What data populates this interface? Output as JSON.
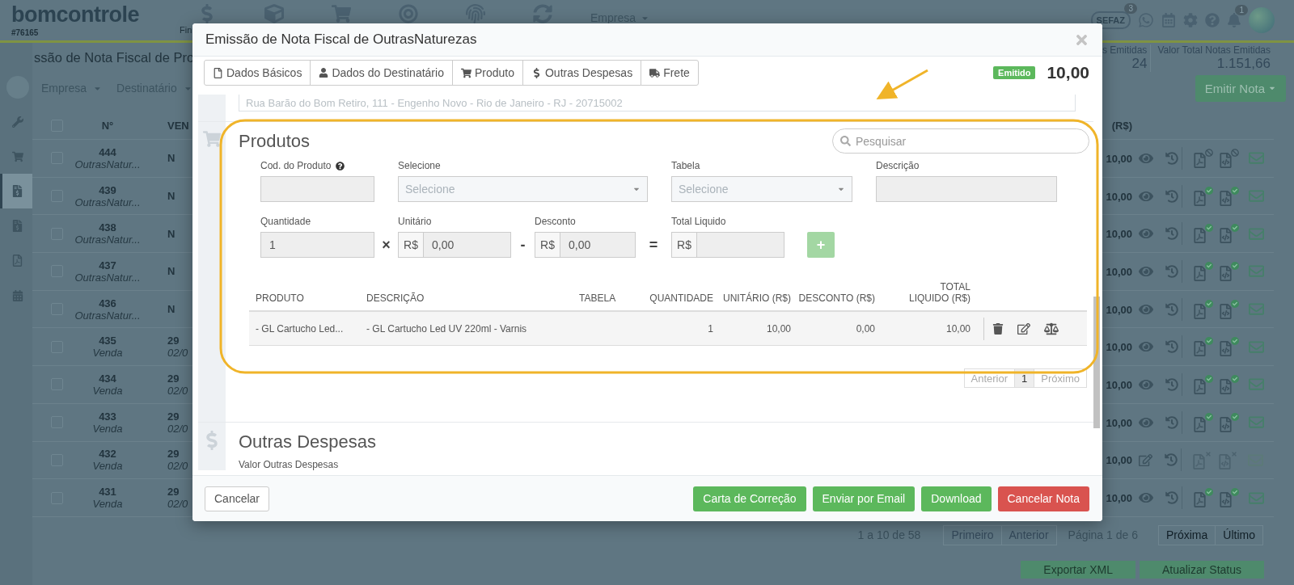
{
  "header": {
    "logo": "bomcontrole",
    "account": "#76165",
    "nav_label": "Fin",
    "company_menu": "Empresa",
    "cloud_label": "SEFAZ",
    "cloud_badge": "3",
    "bell_badge": "1"
  },
  "page": {
    "title": "ssão de Nota Fiscal de Pro",
    "stats": [
      {
        "label": "s Emitidas",
        "value": "24"
      },
      {
        "label": "Valor Total Notas Emitidas",
        "value": "1.151,66"
      }
    ],
    "filters": [
      "Empresa",
      "Destinatário"
    ],
    "emit_button": "Emitir Nota"
  },
  "sidebar": [
    {
      "kind": "profile",
      "selected": false
    },
    {
      "kind": "wrench",
      "selected": false
    },
    {
      "kind": "cart",
      "selected": false
    },
    {
      "kind": "invoice",
      "selected": true
    },
    {
      "kind": "invoice",
      "selected": false
    },
    {
      "kind": "pdf",
      "selected": false
    },
    {
      "kind": "calendar",
      "selected": false
    }
  ],
  "table": {
    "select_all": {
      "checked": false
    },
    "columns": [
      "N°",
      "VEN",
      "(R$)"
    ],
    "rows": [
      {
        "checked": false,
        "number": "444",
        "type": "OutrasNatur...",
        "column_3": "N",
        "total": "10,00",
        "kind": "canceled"
      },
      {
        "checked": false,
        "number": "439",
        "type": "OutrasNatur...",
        "column_3": "N",
        "total": "10,00",
        "kind": "issued"
      },
      {
        "checked": false,
        "number": "438",
        "type": "OutrasNatur...",
        "column_3": "N",
        "total": "10,00",
        "kind": "issued"
      },
      {
        "checked": false,
        "number": "437",
        "type": "OutrasNatur...",
        "column_3": "N",
        "total": "10,00",
        "kind": "issued"
      },
      {
        "checked": false,
        "number": "436",
        "type": "OutrasNatur...",
        "column_3": "N",
        "total": "10,00",
        "kind": "issued"
      },
      {
        "checked": false,
        "number": "435",
        "type": "Venda",
        "column_3": "29",
        "column_3_sub": "02/0",
        "total": "10,00",
        "kind": "issued"
      },
      {
        "checked": false,
        "number": "434",
        "type": "Venda",
        "column_3": "29",
        "column_3_sub": "02/0",
        "total": "10,00",
        "kind": "issued"
      },
      {
        "checked": false,
        "number": "433",
        "type": "Venda",
        "column_3": "29",
        "column_3_sub": "02/0",
        "total": "10,00",
        "kind": "issued"
      },
      {
        "checked": false,
        "number": "432",
        "type": "Venda",
        "column_3": "29",
        "column_3_sub": "02/0",
        "total": "10,00",
        "kind": "draft"
      },
      {
        "checked": false,
        "number": "431",
        "type": "Venda",
        "column_3": "29",
        "column_3_sub": "02/0",
        "total": "10,00",
        "kind": "issued"
      }
    ]
  },
  "pagination": {
    "summary": "1 a 10 de 58",
    "back": [
      {
        "label": "Primeiro",
        "disabled": true
      },
      {
        "label": "Anterior",
        "disabled": true
      }
    ],
    "page_label": "Página 1 de 6",
    "forward": [
      {
        "label": "Próxima",
        "disabled": false
      },
      {
        "label": "Último",
        "disabled": false
      }
    ]
  },
  "bottom_buttons": [
    "Exportar XML",
    "Atualizar Status"
  ],
  "modal": {
    "title": "Emissão de Nota Fiscal de OutrasNaturezas",
    "tabs": [
      {
        "kind": "file",
        "label": "Dados Básicos",
        "selected": false
      },
      {
        "kind": "user",
        "label": "Dados do Destinatário",
        "selected": false
      },
      {
        "kind": "cart",
        "label": "Produto",
        "selected": false
      },
      {
        "kind": "dollar",
        "label": "Outras Despesas",
        "selected": false
      },
      {
        "kind": "truck",
        "label": "Frete",
        "selected": false
      }
    ],
    "status": "Emitido",
    "total": "10,00",
    "address": "Rua Barão do Bom Retiro, 111 - Engenho Novo - Rio de Janeiro - RJ - 20715002",
    "products": {
      "title": "Produtos",
      "search": {
        "placeholder": "Pesquisar"
      },
      "row_1": [
        {
          "kind": "input",
          "label": "Cod. do Produto",
          "help": true
        },
        {
          "kind": "select",
          "label": "Selecione",
          "placeholder": "Selecione"
        },
        {
          "kind": "select",
          "label": "Tabela",
          "placeholder": "Selecione"
        },
        {
          "kind": "input",
          "label": "Descrição"
        }
      ],
      "row_2": [
        {
          "kind": "input",
          "label": "Quantidade",
          "value": "1"
        },
        {
          "kind": "money",
          "operator": "×",
          "label": "Unitário",
          "prefix": "R$",
          "value": "0,00"
        },
        {
          "kind": "money",
          "operator": "-",
          "label": "Desconto",
          "prefix": "R$",
          "value": "0,00"
        },
        {
          "kind": "money",
          "operator": "=",
          "label": "Total Liquido",
          "prefix": "R$"
        }
      ],
      "add_button": {
        "label": "+",
        "disabled": true
      },
      "columns": [
        "PRODUTO",
        "DESCRIÇÃO",
        "TABELA",
        "QUANTIDADE",
        "UNITÁRIO (R$)",
        "DESCONTO (R$)",
        "TOTAL LIQUIDO (R$)"
      ],
      "rows": [
        {
          "product": "- GL Cartucho Led...",
          "description": "- GL Cartucho Led UV 220ml - Varnis",
          "quantity": "1",
          "unit": "10,00",
          "discount": "0,00",
          "total": "10,00"
        }
      ],
      "pagination": [
        {
          "label": "Anterior",
          "disabled": true,
          "selected": false
        },
        {
          "label": "1",
          "disabled": false,
          "selected": true
        },
        {
          "label": "Próximo",
          "disabled": true,
          "selected": false
        }
      ]
    },
    "other_expenses": {
      "title": "Outras Despesas",
      "field_label": "Valor Outras Despesas"
    },
    "footer": {
      "cancel": "Cancelar",
      "actions": [
        {
          "label": "Carta de Correção",
          "kind": "success"
        },
        {
          "label": "Enviar por Email",
          "kind": "success"
        },
        {
          "label": "Download",
          "kind": "success"
        },
        {
          "label": "Cancelar Nota",
          "kind": "danger"
        }
      ]
    }
  }
}
